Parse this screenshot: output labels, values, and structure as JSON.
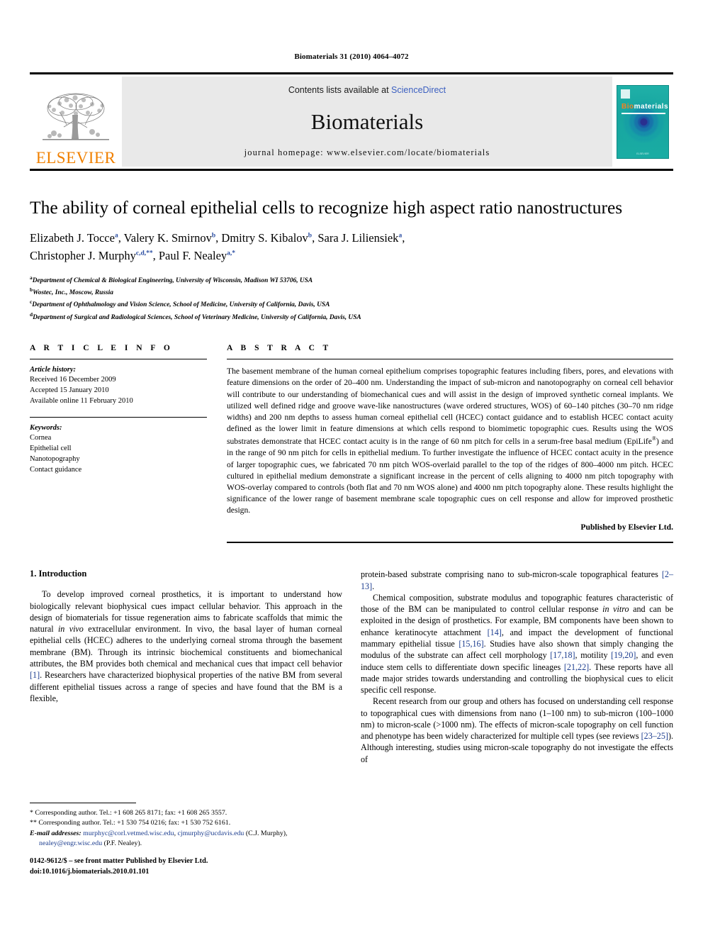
{
  "running_head": "Biomaterials 31 (2010) 4064–4072",
  "banner": {
    "publisher_wordmark": "ELSEVIER",
    "contents_prefix": "Contents lists available at ",
    "contents_link": "ScienceDirect",
    "journal_name": "Biomaterials",
    "homepage": "journal homepage: www.elsevier.com/locate/biomaterials",
    "cover": {
      "title_part1": "Bio",
      "title_part2": "materials",
      "footer": "ELSEVIER",
      "accent_color": "#F58220",
      "background_color": "#16a39c"
    }
  },
  "article": {
    "title": "The ability of corneal epithelial cells to recognize high aspect ratio nanostructures",
    "authors_line1": "Elizabeth J. Tocce",
    "authors": [
      {
        "name": "Elizabeth J. Tocce",
        "marks": "a"
      },
      {
        "name": "Valery K. Smirnov",
        "marks": "b"
      },
      {
        "name": "Dmitry S. Kibalov",
        "marks": "b"
      },
      {
        "name": "Sara J. Liliensiek",
        "marks": "a"
      },
      {
        "name": "Christopher J. Murphy",
        "marks": "c,d,**"
      },
      {
        "name": "Paul F. Nealey",
        "marks": "a,*"
      }
    ],
    "affiliations": [
      {
        "mark": "a",
        "text": "Department of Chemical & Biological Engineering, University of Wisconsin, Madison WI 53706, USA"
      },
      {
        "mark": "b",
        "text": "Wostec, Inc., Moscow, Russia"
      },
      {
        "mark": "c",
        "text": "Department of Ophthalmology and Vision Science, School of Medicine, University of California, Davis, USA"
      },
      {
        "mark": "d",
        "text": "Department of Surgical and Radiological Sciences, School of Veterinary Medicine, University of California, Davis, USA"
      }
    ]
  },
  "article_info": {
    "heading": "A R T I C L E   I N F O",
    "history_label": "Article history:",
    "history": [
      "Received 16 December 2009",
      "Accepted 15 January 2010",
      "Available online 11 February 2010"
    ],
    "keywords_label": "Keywords:",
    "keywords": [
      "Cornea",
      "Epithelial cell",
      "Nanotopography",
      "Contact guidance"
    ]
  },
  "abstract": {
    "heading": "A B S T R A C T",
    "text": "The basement membrane of the human corneal epithelium comprises topographic features including fibers, pores, and elevations with feature dimensions on the order of 20–400 nm. Understanding the impact of sub-micron and nanotopography on corneal cell behavior will contribute to our understanding of biomechanical cues and will assist in the design of improved synthetic corneal implants. We utilized well defined ridge and groove wave-like nanostructures (wave ordered structures, WOS) of 60–140 pitches (30–70 nm ridge widths) and 200 nm depths to assess human corneal epithelial cell (HCEC) contact guidance and to establish HCEC contact acuity defined as the lower limit in feature dimensions at which cells respond to biomimetic topographic cues. Results using the WOS substrates demonstrate that HCEC contact acuity is in the range of 60 nm pitch for cells in a serum-free basal medium (EpiLife®) and in the range of 90 nm pitch for cells in epithelial medium. To further investigate the influence of HCEC contact acuity in the presence of larger topographic cues, we fabricated 70 nm pitch WOS-overlaid parallel to the top of the ridges of 800–4000 nm pitch. HCEC cultured in epithelial medium demonstrate a significant increase in the percent of cells aligning to 4000 nm pitch topography with WOS-overlay compared to controls (both flat and 70 nm WOS alone) and 4000 nm pitch topography alone. These results highlight the significance of the lower range of basement membrane scale topographic cues on cell response and allow for improved prosthetic design.",
    "published_by": "Published by Elsevier Ltd."
  },
  "introduction": {
    "section_title": "1.  Introduction",
    "left_paragraphs": [
      "To develop improved corneal prosthetics, it is important to understand how biologically relevant biophysical cues impact cellular behavior. This approach in the design of biomaterials for tissue regeneration aims to fabricate scaffolds that mimic the natural in vivo extracellular environment. In vivo, the basal layer of human corneal epithelial cells (HCEC) adheres to the underlying corneal stroma through the basement membrane (BM). Through its intrinsic biochemical constituents and biomechanical attributes, the BM provides both chemical and mechanical cues that impact cell behavior [1]. Researchers have characterized biophysical properties of the native BM from several different epithelial tissues across a range of species and have found that the BM is a flexible,"
    ],
    "right_paragraphs": [
      "protein-based substrate comprising nano to sub-micron-scale topographical features [2–13].",
      "Chemical composition, substrate modulus and topographic features characteristic of those of the BM can be manipulated to control cellular response in vitro and can be exploited in the design of prosthetics. For example, BM components have been shown to enhance keratinocyte attachment [14], and impact the development of functional mammary epithelial tissue [15,16]. Studies have also shown that simply changing the modulus of the substrate can affect cell morphology [17,18], motility [19,20], and even induce stem cells to differentiate down specific lineages [21,22]. These reports have all made major strides towards understanding and controlling the biophysical cues to elicit specific cell response.",
      "Recent research from our group and others has focused on understanding cell response to topographical cues with dimensions from nano (1–100 nm) to sub-micron (100–1000 nm) to micron-scale (>1000 nm). The effects of micron-scale topography on cell function and phenotype has been widely characterized for multiple cell types (see reviews [23–25]). Although interesting, studies using micron-scale topography do not investigate the effects of"
    ]
  },
  "footnotes": {
    "line1": "* Corresponding author. Tel.: +1 608 265 8171; fax: +1 608 265 3557.",
    "line2": "** Corresponding author. Tel.: +1 530 754 0216; fax: +1 530 752 6161.",
    "email_label": "E-mail addresses:",
    "email1": "murphyc@corl.vetmed.wisc.edu",
    "email2": "cjmurphy@ucdavis.edu",
    "email2_owner": "(C.J. Murphy),",
    "email3": "nealey@engr.wisc.edu",
    "email3_owner": "(P.F. Nealey)."
  },
  "footer": {
    "issn_line": "0142-9612/$ – see front matter Published by Elsevier Ltd.",
    "doi_line": "doi:10.1016/j.biomaterials.2010.01.101"
  }
}
